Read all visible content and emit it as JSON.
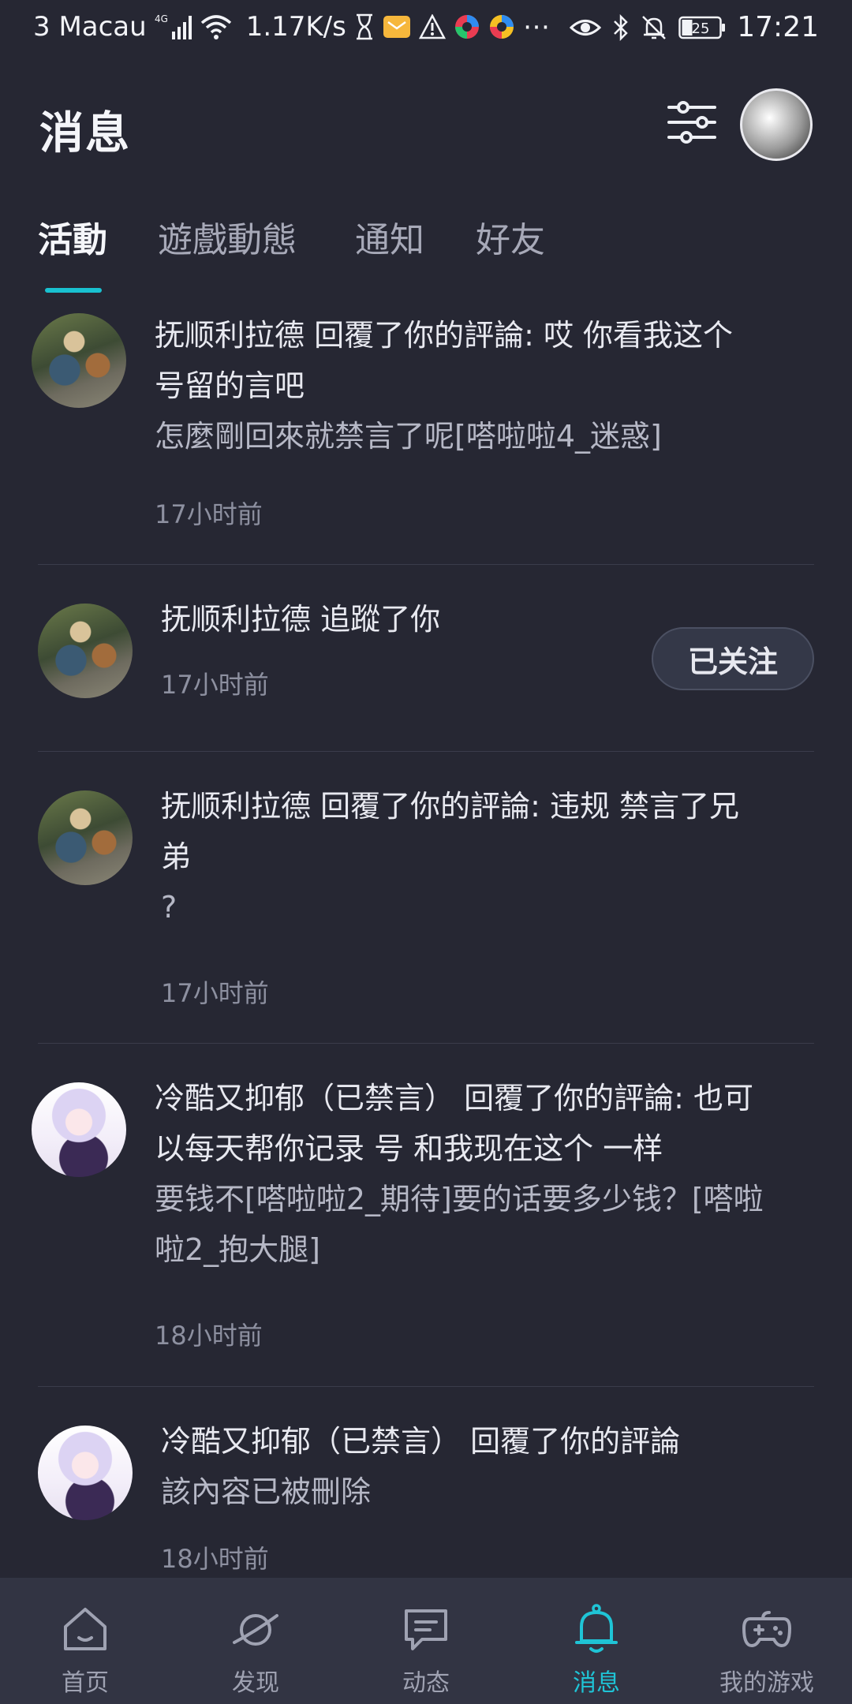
{
  "status_bar": {
    "carrier": "3 Macau",
    "network": "4G",
    "speed": "1.17K/s",
    "battery": "25",
    "time": "17:21"
  },
  "header": {
    "title": "消息"
  },
  "tabs": [
    {
      "label": "活動",
      "active": true
    },
    {
      "label": "遊戲動態",
      "active": false
    },
    {
      "label": "通知",
      "active": false
    },
    {
      "label": "好友",
      "active": false
    }
  ],
  "feed": [
    {
      "line1": "抚顺利拉德 回覆了你的評論: 哎 你看我这个",
      "line2": "号留的言吧",
      "line3": "怎麼剛回來就禁言了呢[嗒啦啦4_迷惑]",
      "time": "17小时前"
    },
    {
      "line1": "抚顺利拉德 追蹤了你",
      "time": "17小时前",
      "button": "已关注"
    },
    {
      "line1": "抚顺利拉德 回覆了你的評論: 违规 禁言了兄",
      "line2": "弟",
      "line3": "?",
      "time": "17小时前"
    },
    {
      "line1": "冷酷又抑郁（已禁言） 回覆了你的評論: 也可",
      "line2": "以每天帮你记录 号 和我现在这个 一样",
      "line3": "要钱不[嗒啦啦2_期待]要的话要多少钱？[嗒啦",
      "line4": "啦2_抱大腿]",
      "time": "18小时前"
    },
    {
      "line1": "冷酷又抑郁（已禁言） 回覆了你的評論",
      "line2": "該內容已被刪除",
      "time": "18小时前"
    }
  ],
  "bottom_nav": [
    {
      "label": "首页",
      "icon": "home-icon",
      "active": false
    },
    {
      "label": "发现",
      "icon": "planet-icon",
      "active": false
    },
    {
      "label": "动态",
      "icon": "chat-icon",
      "active": false
    },
    {
      "label": "消息",
      "icon": "bell-icon",
      "active": true
    },
    {
      "label": "我的游戏",
      "icon": "gamepad-icon",
      "active": false
    }
  ],
  "colors": {
    "background": "#262733",
    "accent": "#19c1d0",
    "nav_background": "#323443"
  }
}
